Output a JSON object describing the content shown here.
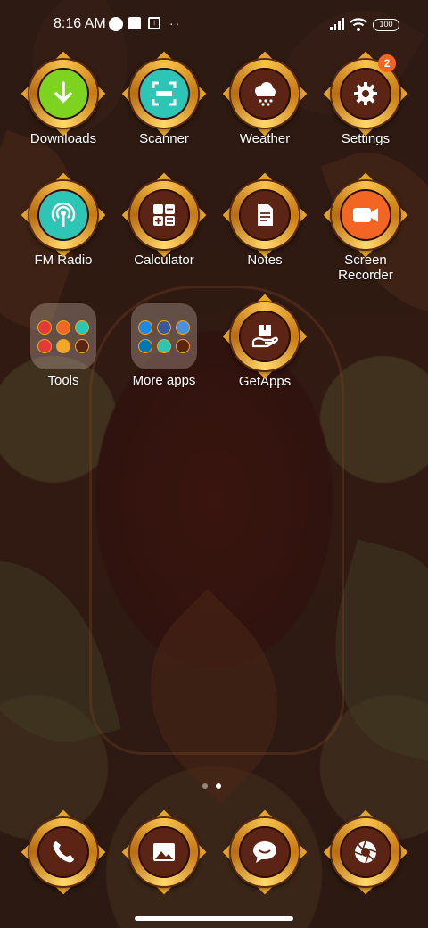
{
  "status_bar": {
    "time": "8:16 AM",
    "battery": "100"
  },
  "apps": [
    {
      "label": "Downloads",
      "icon": "download-icon",
      "color": "#7ed321"
    },
    {
      "label": "Scanner",
      "icon": "scanner-icon",
      "color": "#2ec4b6"
    },
    {
      "label": "Weather",
      "icon": "weather-icon",
      "color": "#5b2414"
    },
    {
      "label": "Settings",
      "icon": "gear-icon",
      "color": "#5b2414",
      "badge": "2"
    },
    {
      "label": "FM Radio",
      "icon": "radio-icon",
      "color": "#2ec4b6"
    },
    {
      "label": "Calculator",
      "icon": "calculator-icon",
      "color": "#5b2414"
    },
    {
      "label": "Notes",
      "icon": "notes-icon",
      "color": "#5b2414"
    },
    {
      "label": "Screen\nRecorder",
      "icon": "video-camera-icon",
      "color": "#f26522"
    },
    {
      "label": "GetApps",
      "icon": "getapps-icon",
      "color": "#5b2414"
    }
  ],
  "folders": [
    {
      "label": "Tools"
    },
    {
      "label": "More apps"
    }
  ],
  "page_indicator": {
    "pages": 2,
    "current": 2
  },
  "dock": [
    {
      "icon": "phone-icon"
    },
    {
      "icon": "gallery-icon"
    },
    {
      "icon": "messages-icon"
    },
    {
      "icon": "camera-icon"
    }
  ]
}
